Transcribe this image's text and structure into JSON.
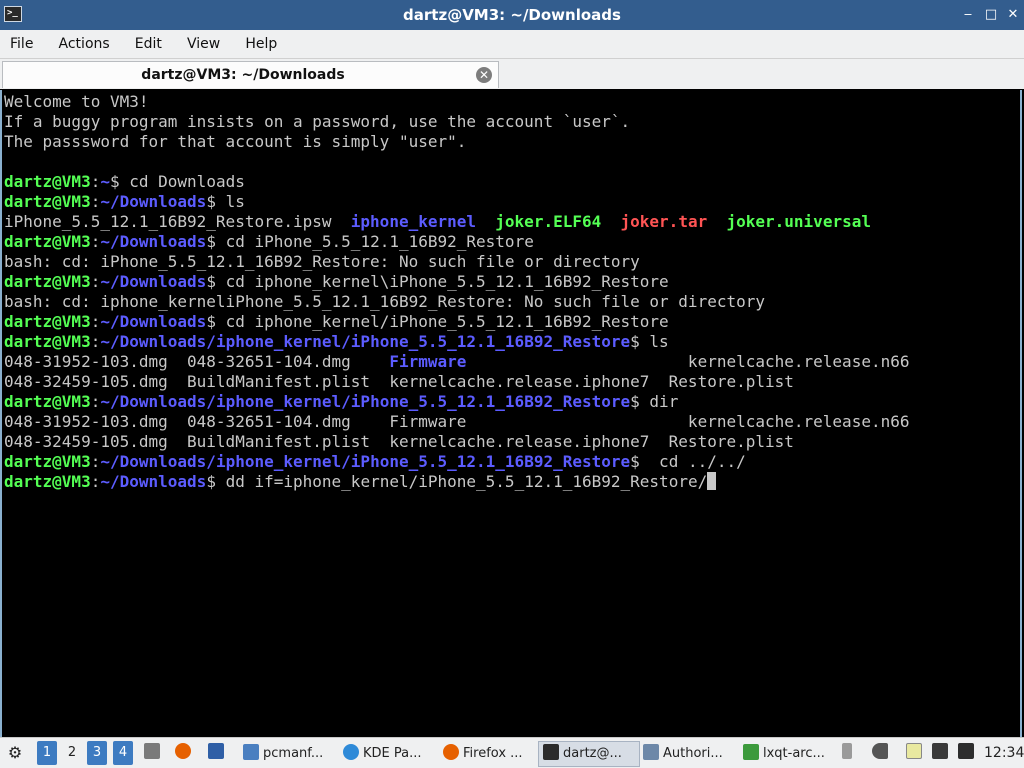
{
  "window": {
    "title": "dartz@VM3: ~/Downloads",
    "app_icon_text": ">_",
    "minimize": "‒",
    "maximize": "□",
    "close": "✕"
  },
  "menu": {
    "items": [
      "File",
      "Actions",
      "Edit",
      "View",
      "Help"
    ]
  },
  "tab": {
    "label": "dartz@VM3: ~/Downloads",
    "close": "✕"
  },
  "terminal": {
    "lines": [
      [
        {
          "t": "Welcome to VM3!",
          "c": "t"
        }
      ],
      [
        {
          "t": "If a buggy program insists on a password, use the account `user`.",
          "c": "t"
        }
      ],
      [
        {
          "t": "The passsword for that account is simply \"user\".",
          "c": "t"
        }
      ],
      [],
      [
        {
          "t": "dartz@VM3",
          "c": "u"
        },
        {
          "t": ":",
          "c": "t"
        },
        {
          "t": "~",
          "c": "d"
        },
        {
          "t": "$ cd Downloads",
          "c": "t"
        }
      ],
      [
        {
          "t": "dartz@VM3",
          "c": "u"
        },
        {
          "t": ":",
          "c": "t"
        },
        {
          "t": "~/Downloads",
          "c": "d"
        },
        {
          "t": "$ ls",
          "c": "t"
        }
      ],
      [
        {
          "t": "iPhone_5.5_12.1_16B92_Restore.ipsw  ",
          "c": "t"
        },
        {
          "t": "iphone_kernel",
          "c": "d"
        },
        {
          "t": "  ",
          "c": "t"
        },
        {
          "t": "joker.ELF64",
          "c": "g"
        },
        {
          "t": "  ",
          "c": "t"
        },
        {
          "t": "joker.tar",
          "c": "r"
        },
        {
          "t": "  ",
          "c": "t"
        },
        {
          "t": "joker.universal",
          "c": "g"
        }
      ],
      [
        {
          "t": "dartz@VM3",
          "c": "u"
        },
        {
          "t": ":",
          "c": "t"
        },
        {
          "t": "~/Downloads",
          "c": "d"
        },
        {
          "t": "$ cd iPhone_5.5_12.1_16B92_Restore",
          "c": "t"
        }
      ],
      [
        {
          "t": "bash: cd: iPhone_5.5_12.1_16B92_Restore: No such file or directory",
          "c": "t"
        }
      ],
      [
        {
          "t": "dartz@VM3",
          "c": "u"
        },
        {
          "t": ":",
          "c": "t"
        },
        {
          "t": "~/Downloads",
          "c": "d"
        },
        {
          "t": "$ cd iphone_kernel\\iPhone_5.5_12.1_16B92_Restore",
          "c": "t"
        }
      ],
      [
        {
          "t": "bash: cd: iphone_kerneliPhone_5.5_12.1_16B92_Restore: No such file or directory",
          "c": "t"
        }
      ],
      [
        {
          "t": "dartz@VM3",
          "c": "u"
        },
        {
          "t": ":",
          "c": "t"
        },
        {
          "t": "~/Downloads",
          "c": "d"
        },
        {
          "t": "$ cd iphone_kernel/iPhone_5.5_12.1_16B92_Restore",
          "c": "t"
        }
      ],
      [
        {
          "t": "dartz@VM3",
          "c": "u"
        },
        {
          "t": ":",
          "c": "t"
        },
        {
          "t": "~/Downloads/iphone_kernel/iPhone_5.5_12.1_16B92_Restore",
          "c": "d"
        },
        {
          "t": "$ ls",
          "c": "t"
        }
      ],
      [
        {
          "t": "048-31952-103.dmg  048-32651-104.dmg    ",
          "c": "t"
        },
        {
          "t": "Firmware",
          "c": "d"
        },
        {
          "t": "                       kernelcache.release.n66",
          "c": "t"
        }
      ],
      [
        {
          "t": "048-32459-105.dmg  BuildManifest.plist  kernelcache.release.iphone7  Restore.plist",
          "c": "t"
        }
      ],
      [
        {
          "t": "dartz@VM3",
          "c": "u"
        },
        {
          "t": ":",
          "c": "t"
        },
        {
          "t": "~/Downloads/iphone_kernel/iPhone_5.5_12.1_16B92_Restore",
          "c": "d"
        },
        {
          "t": "$ dir",
          "c": "t"
        }
      ],
      [
        {
          "t": "048-31952-103.dmg  048-32651-104.dmg    Firmware                       kernelcache.release.n66",
          "c": "t"
        }
      ],
      [
        {
          "t": "048-32459-105.dmg  BuildManifest.plist  kernelcache.release.iphone7  Restore.plist",
          "c": "t"
        }
      ],
      [
        {
          "t": "dartz@VM3",
          "c": "u"
        },
        {
          "t": ":",
          "c": "t"
        },
        {
          "t": "~/Downloads/iphone_kernel/iPhone_5.5_12.1_16B92_Restore",
          "c": "d"
        },
        {
          "t": "$  cd ../../",
          "c": "t"
        }
      ],
      [
        {
          "t": "dartz@VM3",
          "c": "u"
        },
        {
          "t": ":",
          "c": "t"
        },
        {
          "t": "~/Downloads",
          "c": "d"
        },
        {
          "t": "$ dd if=iphone_kernel/iPhone_5.5_12.1_16B92_Restore/",
          "c": "t"
        }
      ]
    ]
  },
  "taskbar": {
    "workspaces": [
      "1",
      "2",
      "3",
      "4"
    ],
    "tasks": [
      {
        "label": "pcmanf...",
        "icon": "folder-icon",
        "color": "#4a7fc0"
      },
      {
        "label": "KDE Pa...",
        "icon": "kde-icon",
        "color": "#2e8ad8"
      },
      {
        "label": "Firefox ...",
        "icon": "firefox-icon",
        "color": "#e66000"
      },
      {
        "label": "dartz@...",
        "icon": "terminal-icon",
        "color": "#2b2b2b"
      },
      {
        "label": "Authori...",
        "icon": "auth-icon",
        "color": "#6d88a8"
      },
      {
        "label": "lxqt-arc...",
        "icon": "archiver-icon",
        "color": "#3c9a3c"
      }
    ],
    "clock": "12:34"
  }
}
